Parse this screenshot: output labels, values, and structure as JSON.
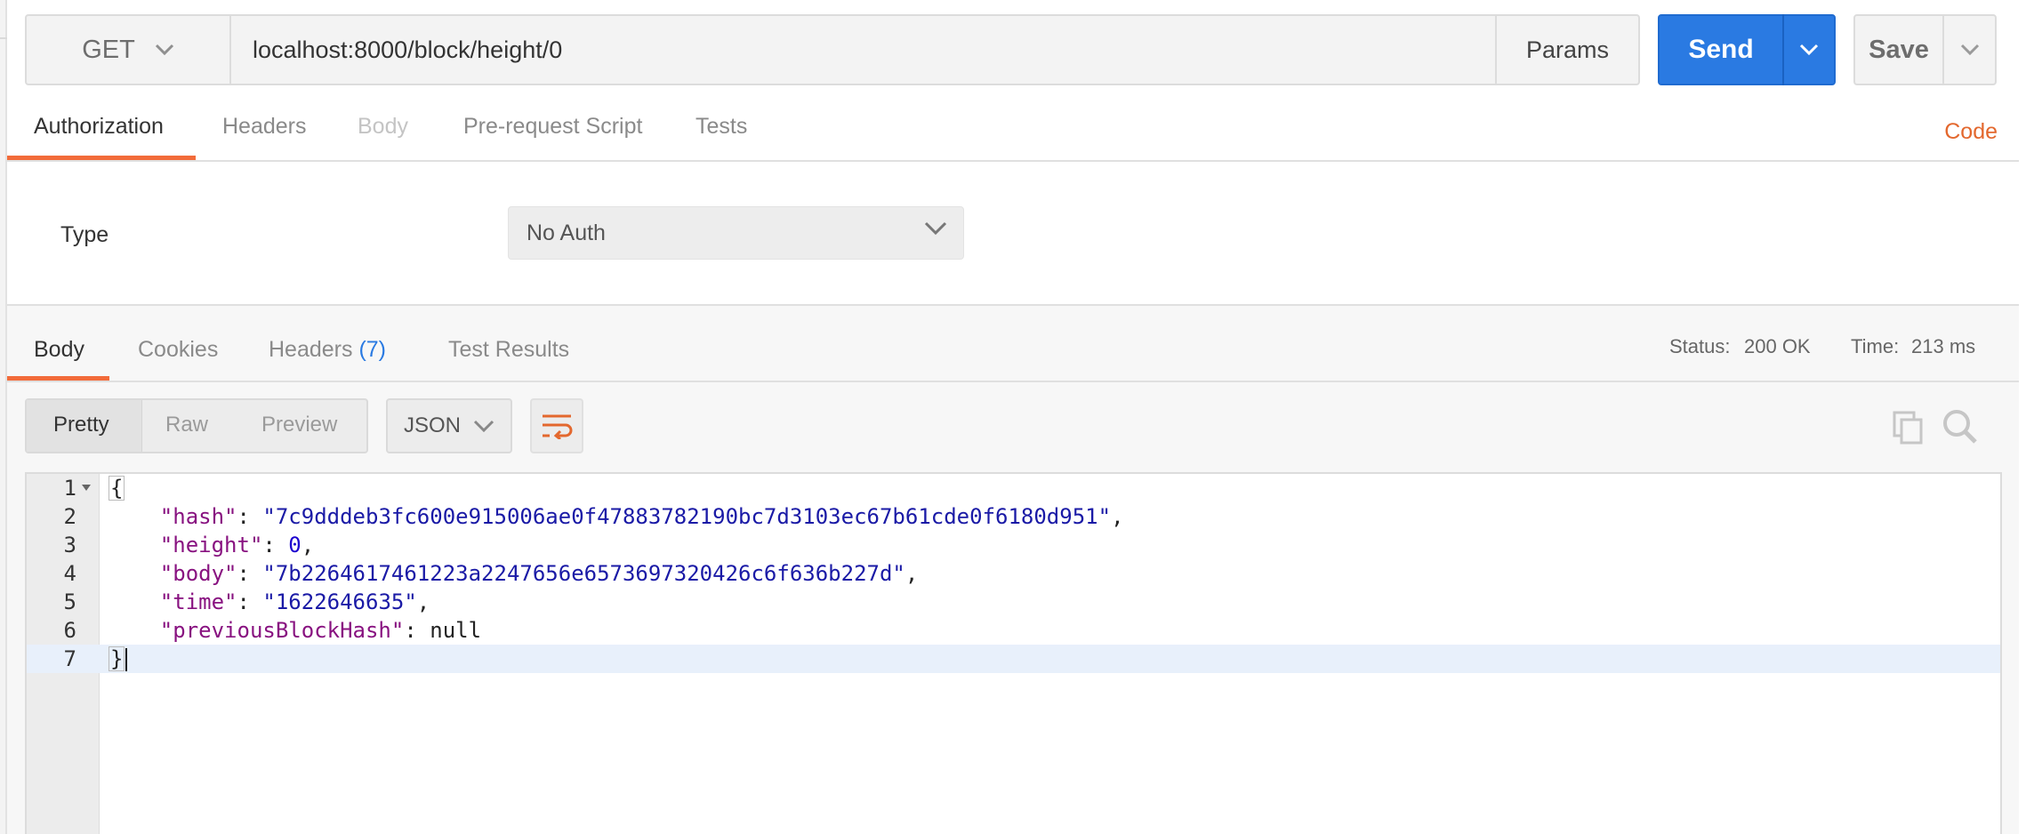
{
  "request": {
    "method": "GET",
    "url": "localhost:8000/block/height/0",
    "params_label": "Params",
    "send_label": "Send",
    "save_label": "Save"
  },
  "request_tabs": [
    {
      "label": "Authorization",
      "state": "active"
    },
    {
      "label": "Headers",
      "state": "normal"
    },
    {
      "label": "Body",
      "state": "disabled"
    },
    {
      "label": "Pre-request Script",
      "state": "normal"
    },
    {
      "label": "Tests",
      "state": "normal"
    }
  ],
  "code_link": "Code",
  "auth": {
    "type_label": "Type",
    "type_value": "No Auth"
  },
  "response_tabs": {
    "body": "Body",
    "cookies": "Cookies",
    "headers": "Headers",
    "headers_count": "(7)",
    "test_results": "Test Results"
  },
  "status": {
    "status_label": "Status:",
    "status_value": "200 OK",
    "time_label": "Time:",
    "time_value": "213 ms"
  },
  "view_modes": {
    "pretty": "Pretty",
    "raw": "Raw",
    "preview": "Preview",
    "format": "JSON"
  },
  "response_json": {
    "line_numbers": [
      "1",
      "2",
      "3",
      "4",
      "5",
      "6",
      "7"
    ],
    "open_brace": "{",
    "close_brace": "}",
    "hash_key": "\"hash\"",
    "hash_value": "\"7c9dddeb3fc600e915006ae0f47883782190bc7d3103ec67b61cde0f6180d951\"",
    "height_key": "\"height\"",
    "height_value": "0",
    "body_key": "\"body\"",
    "body_value": "\"7b2264617461223a2247656e6573697320426c6f636b227d\"",
    "time_key": "\"time\"",
    "time_value": "\"1622646635\"",
    "prev_key": "\"previousBlockHash\"",
    "prev_value": "null"
  },
  "colors": {
    "accent_orange": "#f26b3a",
    "send_blue": "#2a7ae2",
    "json_key": "#881280",
    "json_string": "#1a1aa6"
  },
  "icons": [
    "chevron-down-icon",
    "wrap-lines-icon",
    "copy-icon",
    "search-icon",
    "fold-arrow-icon"
  ]
}
